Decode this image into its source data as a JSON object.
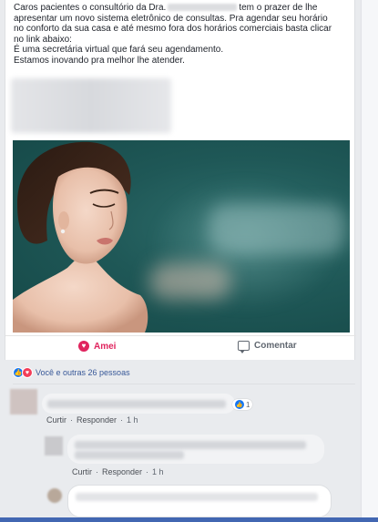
{
  "post": {
    "line1_a": "Caros pacientes o consultório da Dra.",
    "line1_b": "tem o prazer de lhe",
    "line2": "apresentar um novo sistema eletrônico de consultas. Pra agendar seu horário",
    "line3": "no conforto da sua casa e até mesmo fora dos horários comerciais basta clicar",
    "line4": "no link abaixo:",
    "line5": "É uma secretária virtual que fará seu agendamento.",
    "line6": "Estamos inovando pra melhor lhe atender."
  },
  "actions": {
    "amei_label": "Amei",
    "comment_label": "Comentar",
    "amei_color": "#e0245e"
  },
  "reactions": {
    "summary": "Você e outras 26 pessoas",
    "icons": [
      "like-icon",
      "love-icon"
    ]
  },
  "comments": [
    {
      "like_count": "1",
      "actions": {
        "like": "Curtir",
        "reply": "Responder",
        "time": "1 h",
        "sep": "·"
      }
    },
    {
      "actions": {
        "like": "Curtir",
        "reply": "Responder",
        "time": "1 h",
        "sep": "·"
      }
    }
  ],
  "colors": {
    "link": "#385898",
    "facebook_blue": "#4267b2",
    "image_teal": "#1f5857"
  }
}
